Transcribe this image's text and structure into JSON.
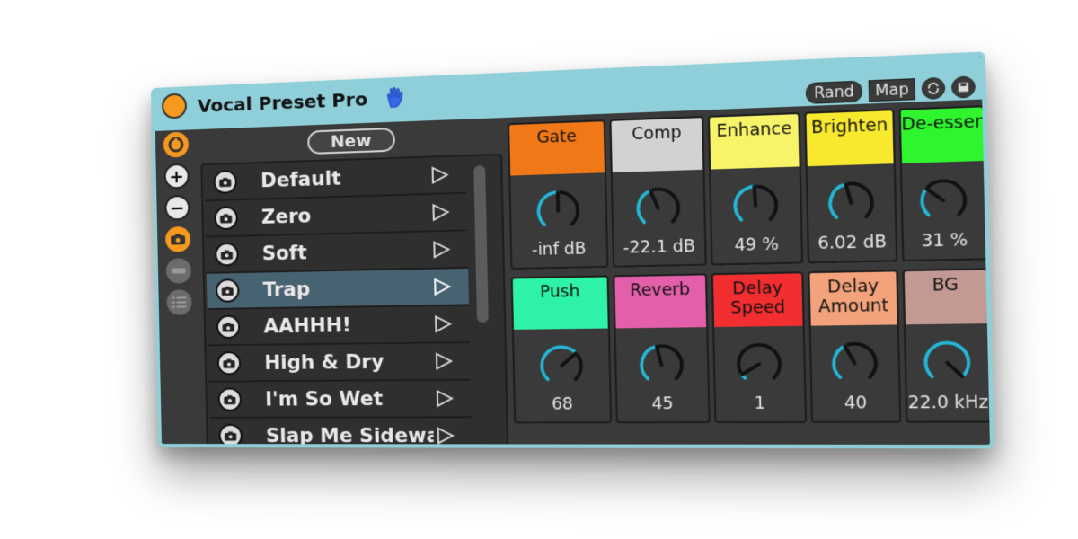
{
  "header": {
    "title": "Vocal Preset Pro",
    "buttons": {
      "rand": "Rand",
      "map": "Map"
    },
    "accent_color": "#8ecfd9",
    "dot_color": "#f59a1f"
  },
  "sidebar": {
    "items": [
      {
        "icon": "power-icon"
      },
      {
        "icon": "plus-icon",
        "label": "+"
      },
      {
        "icon": "minus-icon",
        "label": "−"
      },
      {
        "icon": "camera-icon"
      },
      {
        "icon": "rect-icon"
      },
      {
        "icon": "list-icon"
      }
    ]
  },
  "presets": {
    "new_label": "New",
    "items": [
      "Default",
      "Zero",
      "Soft",
      "Trap",
      "AAHHH!",
      "High & Dry",
      "I'm So Wet",
      "Slap Me Sideway"
    ],
    "selected": "Trap"
  },
  "knobs": [
    {
      "label": "Gate",
      "value": "-inf dB",
      "color": "#f07817",
      "level": 0.5
    },
    {
      "label": "Comp",
      "value": "-22.1 dB",
      "color": "#d2d2d2",
      "level": 0.42
    },
    {
      "label": "Enhance",
      "value": "49 %",
      "color": "#f8f46a",
      "level": 0.49
    },
    {
      "label": "Brighten",
      "value": "6.02 dB",
      "color": "#f8e92e",
      "level": 0.45
    },
    {
      "label": "De-esser",
      "value": "31 %",
      "color": "#2ff52f",
      "level": 0.31
    },
    {
      "label": "Push",
      "value": "68",
      "color": "#2ef2a6",
      "level": 0.68
    },
    {
      "label": "Reverb",
      "value": "45",
      "color": "#e35fa9",
      "level": 0.45
    },
    {
      "label": "Delay\nSpeed",
      "value": "1",
      "color": "#f32e30",
      "level": 0.05
    },
    {
      "label": "Delay\nAmount",
      "value": "40",
      "color": "#f2a37b",
      "level": 0.4
    },
    {
      "label": "BG",
      "value": "22.0 kHz",
      "color": "#c39a93",
      "level": 1.0
    }
  ]
}
